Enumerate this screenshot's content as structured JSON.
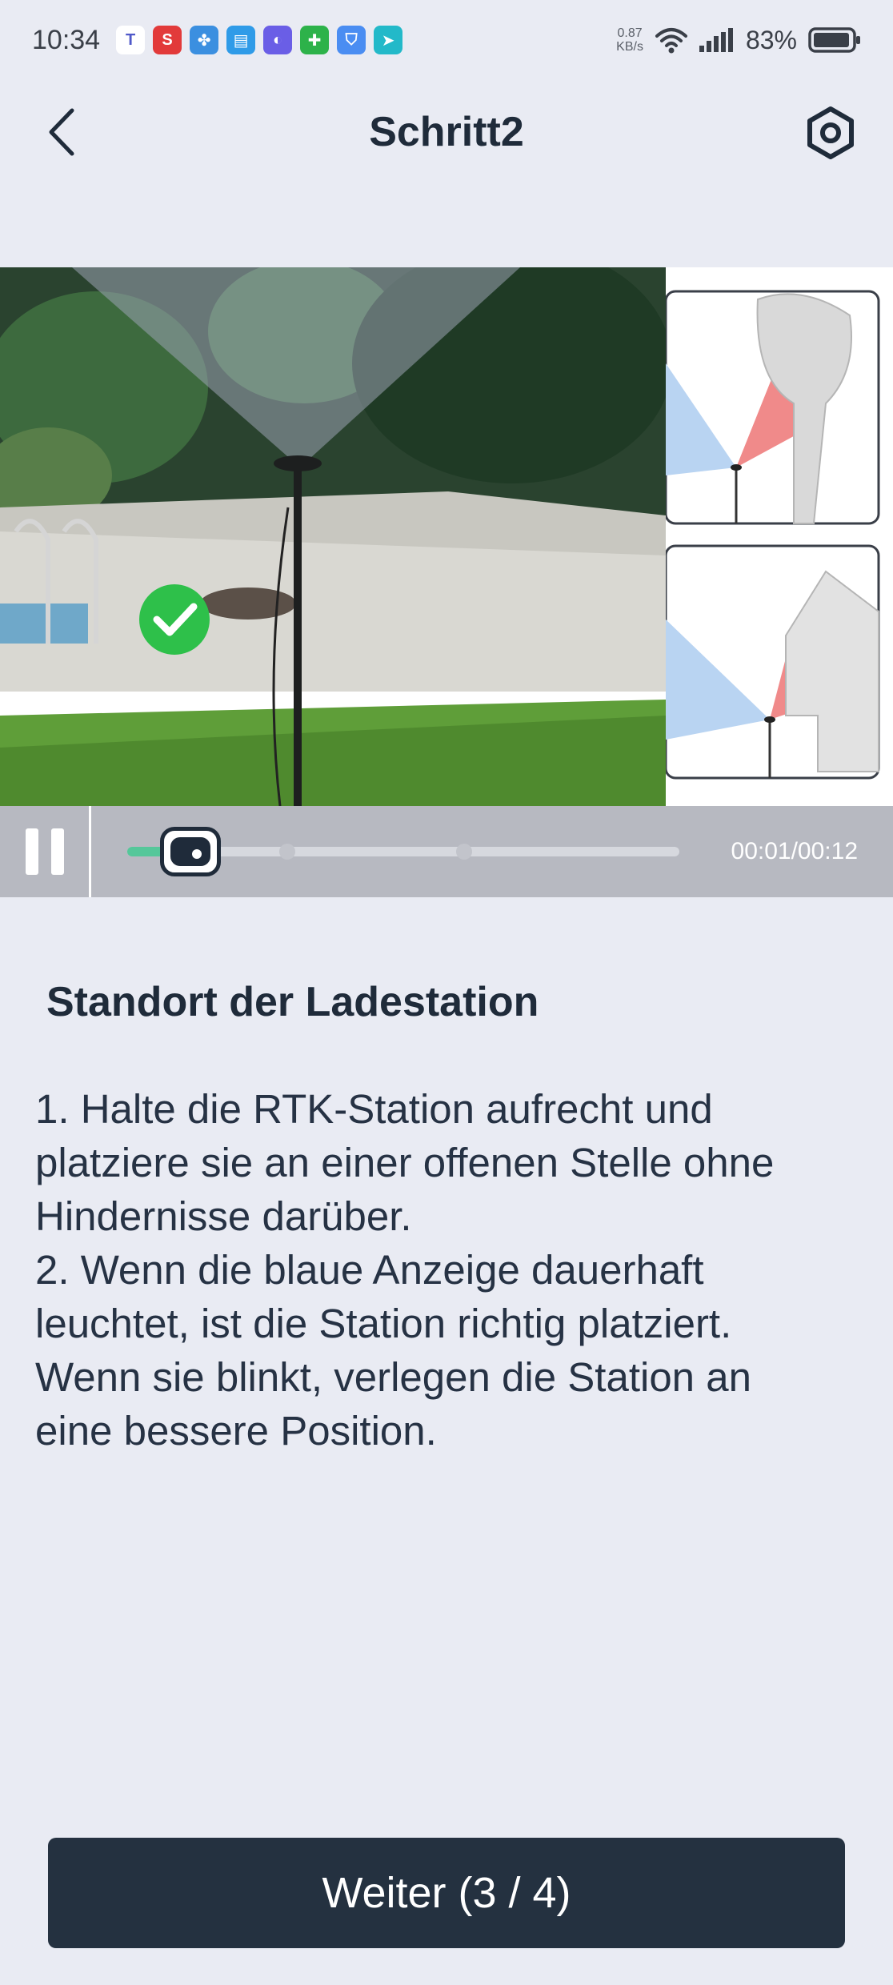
{
  "status_bar": {
    "time": "10:34",
    "net_speed_value": "0.87",
    "net_speed_unit": "KB/s",
    "battery": "83%",
    "notification_icons": [
      "teams-icon",
      "s-app-icon",
      "fan-app-icon",
      "clipboard-app-icon",
      "moon-app-icon",
      "security-app-icon",
      "shield-app-icon",
      "arrow-app-icon"
    ]
  },
  "header": {
    "title": "Schritt2"
  },
  "video": {
    "time_display": "00:01/00:12",
    "progress": 0.083,
    "markers": [
      0.29,
      0.61
    ]
  },
  "content": {
    "heading": "Standort der Ladestation",
    "lines": [
      "1. Halte die RTK-Station aufrecht und",
      "platziere sie an einer offenen Stelle ohne",
      "Hindernisse darüber.",
      "2. Wenn die blaue Anzeige dauerhaft",
      "leuchtet, ist die Station richtig platziert.",
      "Wenn sie blinkt, verlegen die Station an",
      "eine bessere Position."
    ]
  },
  "footer": {
    "next_label": "Weiter (3 / 4)"
  },
  "colors": {
    "background": "#e9ebf3",
    "text_primary": "#1f2b3a",
    "button": "#243140",
    "progress_fill": "#55c79a",
    "check_green": "#2ec04a"
  }
}
